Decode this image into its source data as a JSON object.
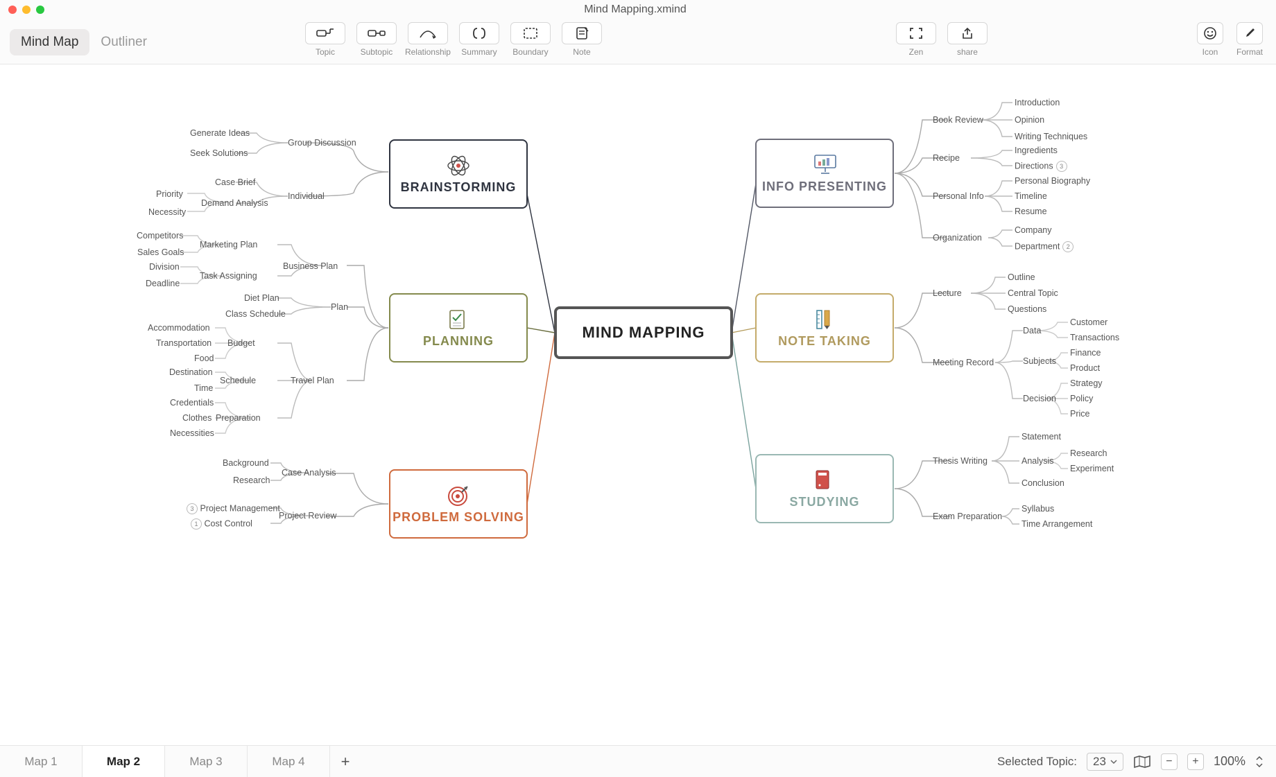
{
  "window": {
    "title": "Mind Mapping.xmind"
  },
  "viewTabs": {
    "mindmap": "Mind Map",
    "outliner": "Outliner"
  },
  "tools": {
    "topic": "Topic",
    "subtopic": "Subtopic",
    "relationship": "Relationship",
    "summary": "Summary",
    "boundary": "Boundary",
    "note": "Note",
    "zen": "Zen",
    "share": "share",
    "icon": "Icon",
    "format": "Format"
  },
  "central": "MIND MAPPING",
  "branches": {
    "brainstorming": {
      "title": "BRAINSTORMING",
      "l2": {
        "group": "Group Discussion",
        "individual": "Individual"
      },
      "l3": {
        "generateIdeas": "Generate Ideas",
        "seekSolutions": "Seek Solutions",
        "caseBrief": "Case Brief",
        "priority": "Priority",
        "necessity": "Necessity",
        "demandAnalysis": "Demand Analysis"
      }
    },
    "planning": {
      "title": "PLANNING",
      "l2": {
        "businessPlan": "Business Plan",
        "plan": "Plan",
        "travelPlan": "Travel Plan"
      },
      "l3": {
        "marketingPlan": "Marketing Plan",
        "taskAssigning": "Task Assigning",
        "dietPlan": "Diet Plan",
        "classSchedule": "Class Schedule",
        "budget": "Budget",
        "schedule": "Schedule",
        "preparation": "Preparation"
      },
      "l4": {
        "competitors": "Competitors",
        "salesGoals": "Sales Goals",
        "division": "Division",
        "deadline": "Deadline",
        "accommodation": "Accommodation",
        "transportation": "Transportation",
        "food": "Food",
        "destination": "Destination",
        "time": "Time",
        "credentials": "Credentials",
        "clothes": "Clothes",
        "necessities": "Necessities"
      }
    },
    "problem": {
      "title": "PROBLEM SOLVING",
      "l2": {
        "caseAnalysis": "Case Analysis",
        "projectReview": "Project Review"
      },
      "l3": {
        "background": "Background",
        "research": "Research",
        "projectManagement": "Project Management",
        "costControl": "Cost Control"
      },
      "badges": {
        "pm": "3",
        "cost": "1"
      }
    },
    "info": {
      "title": "INFO PRESENTING",
      "l2": {
        "bookReview": "Book Review",
        "recipe": "Recipe",
        "personalInfo": "Personal Info",
        "organization": "Organization"
      },
      "l3": {
        "introduction": "Introduction",
        "opinion": "Opinion",
        "writingTechniques": "Writing Techniques",
        "ingredients": "Ingredients",
        "directions": "Directions",
        "personalBio": "Personal Biography",
        "timeline": "Timeline",
        "resume": "Resume",
        "company": "Company",
        "department": "Department"
      },
      "badges": {
        "directions": "3",
        "department": "2"
      }
    },
    "note": {
      "title": "NOTE TAKING",
      "l2": {
        "lecture": "Lecture",
        "meetingRecord": "Meeting Record"
      },
      "l3": {
        "outline": "Outline",
        "centralTopic": "Central Topic",
        "questions": "Questions",
        "data": "Data",
        "subjects": "Subjects",
        "decision": "Decision"
      },
      "l4": {
        "customer": "Customer",
        "transactions": "Transactions",
        "finance": "Finance",
        "product": "Product",
        "strategy": "Strategy",
        "policy": "Policy",
        "price": "Price"
      }
    },
    "study": {
      "title": "STUDYING",
      "l2": {
        "thesis": "Thesis Writing",
        "exam": "Exam Preparation"
      },
      "l3": {
        "statement": "Statement",
        "analysis": "Analysis",
        "conclusion": "Conclusion",
        "syllabus": "Syllabus",
        "timeArrangement": "Time Arrangement",
        "research": "Research",
        "experiment": "Experiment"
      }
    }
  },
  "sheets": {
    "s1": "Map 1",
    "s2": "Map 2",
    "s3": "Map 3",
    "s4": "Map 4"
  },
  "status": {
    "selectedLabel": "Selected Topic:",
    "selectedCount": "23",
    "zoom": "100%"
  }
}
